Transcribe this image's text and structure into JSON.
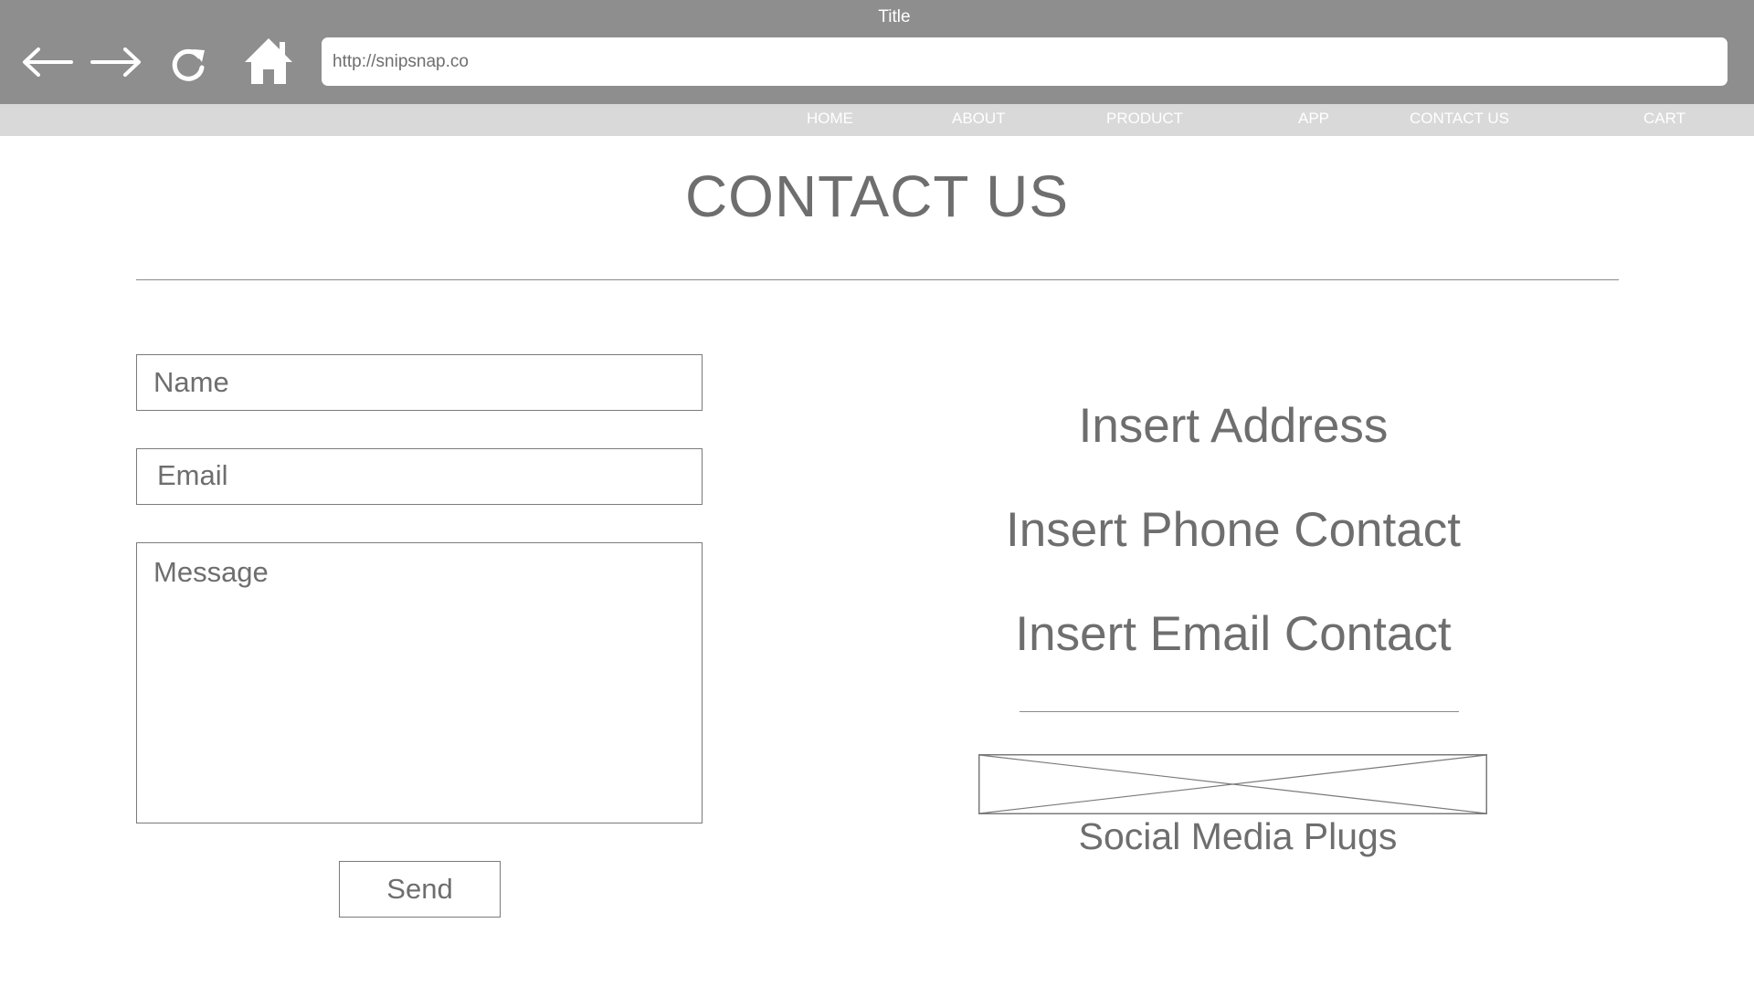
{
  "window": {
    "title": "Title"
  },
  "browser": {
    "url": "http://snipsnap.co",
    "icons": [
      "back-arrow-icon",
      "forward-arrow-icon",
      "refresh-icon",
      "home-icon"
    ]
  },
  "nav": {
    "items": [
      {
        "label": "HOME"
      },
      {
        "label": "ABOUT"
      },
      {
        "label": "PRODUCT"
      },
      {
        "label": "APP"
      },
      {
        "label": "CONTACT US"
      },
      {
        "label": "CART"
      }
    ]
  },
  "page": {
    "title": "CONTACT US"
  },
  "form": {
    "name_placeholder": "Name",
    "email_placeholder": "Email",
    "message_placeholder": "Message",
    "send_label": "Send"
  },
  "contact": {
    "address": "Insert Address",
    "phone": "Insert Phone Contact",
    "email": "Insert Email Contact"
  },
  "social": {
    "label": "Social Media Plugs"
  },
  "colors": {
    "topbar": "#8e8e8e",
    "menubar": "#d9d9d9",
    "text": "#6e6e6e",
    "border": "#7a7a7a"
  }
}
